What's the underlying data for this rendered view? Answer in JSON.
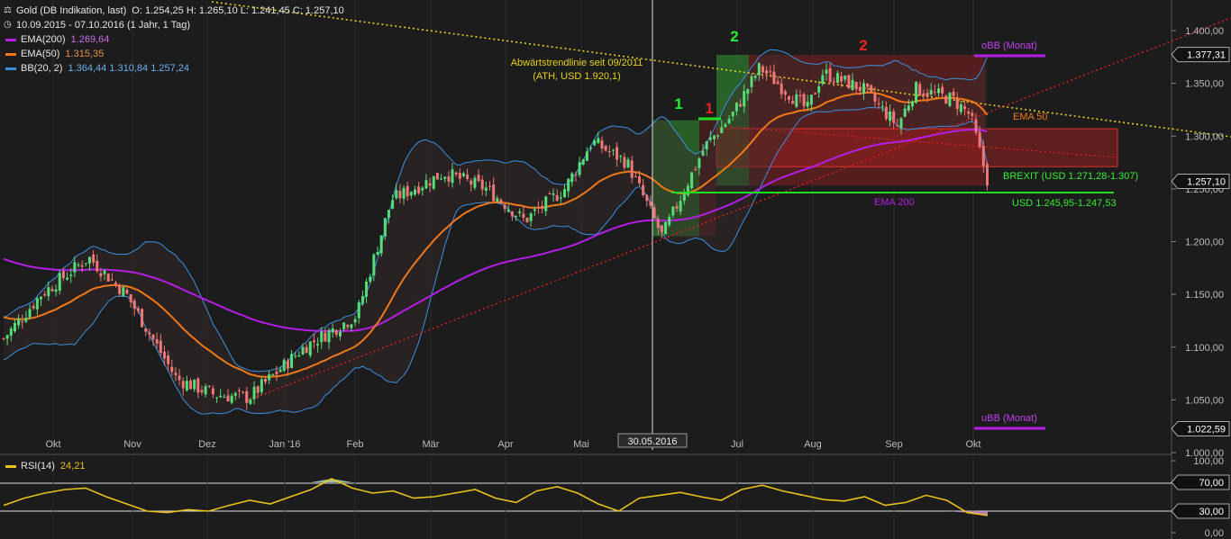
{
  "header": {
    "title": "Gold (DB Indikation, last)",
    "ohlc": "O: 1.254,25  H: 1.265,10  L: 1.241,45  C: 1.257,10",
    "range": "10.09.2015 - 07.10.2016 (1 Jahr, 1 Tag)"
  },
  "legend": [
    {
      "label": "EMA(200)",
      "values": "1.269,64",
      "color": "#b41ee6"
    },
    {
      "label": "EMA(50)",
      "values": "1.315,35",
      "color": "#f07818"
    },
    {
      "label": "BB(20, 2)",
      "values": "1.364,44  1.310,84  1.257,24",
      "color": "#3a90e0"
    }
  ],
  "rsi": {
    "label": "RSI(14)",
    "value": "24,21"
  },
  "colors": {
    "up": "#55dd77",
    "down": "#ee7777",
    "ema200": "#b41ee6",
    "ema50": "#f07818",
    "bb": "#3a90e0",
    "rsi": "#e8c21a"
  },
  "chart_data": {
    "type": "candlestick",
    "ylim": [
      1000,
      1420
    ],
    "y_ticks": [
      "1.400,00",
      "1.350,00",
      "1.300,00",
      "1.250,00",
      "1.200,00",
      "1.150,00",
      "1.100,00",
      "1.050,00",
      "1.000,00"
    ],
    "x_ticks": [
      "Okt",
      "Nov",
      "Dez",
      "Jan '16",
      "Feb",
      "Mär",
      "Apr",
      "Mai",
      "Jul",
      "Aug",
      "Sep",
      "Okt"
    ],
    "crosshair_date": "30.05.2016",
    "price_labels": [
      "1.377,31",
      "1.257,10",
      "1.022,59"
    ],
    "close_series": [
      {
        "date": "2015-09-10",
        "value": 1108
      },
      {
        "date": "2015-09-25",
        "value": 1150
      },
      {
        "date": "2015-10-14",
        "value": 1185
      },
      {
        "date": "2015-10-29",
        "value": 1150
      },
      {
        "date": "2015-11-18",
        "value": 1070
      },
      {
        "date": "2015-12-03",
        "value": 1055
      },
      {
        "date": "2015-12-17",
        "value": 1052
      },
      {
        "date": "2016-01-08",
        "value": 1100
      },
      {
        "date": "2016-01-29",
        "value": 1130
      },
      {
        "date": "2016-02-12",
        "value": 1240
      },
      {
        "date": "2016-03-04",
        "value": 1265
      },
      {
        "date": "2016-03-21",
        "value": 1250
      },
      {
        "date": "2016-04-05",
        "value": 1220
      },
      {
        "date": "2016-04-21",
        "value": 1250
      },
      {
        "date": "2016-05-02",
        "value": 1295
      },
      {
        "date": "2016-05-16",
        "value": 1275
      },
      {
        "date": "2016-05-30",
        "value": 1205
      },
      {
        "date": "2016-06-16",
        "value": 1290
      },
      {
        "date": "2016-06-27",
        "value": 1320
      },
      {
        "date": "2016-07-08",
        "value": 1365
      },
      {
        "date": "2016-07-27",
        "value": 1325
      },
      {
        "date": "2016-08-02",
        "value": 1360
      },
      {
        "date": "2016-08-18",
        "value": 1345
      },
      {
        "date": "2016-09-01",
        "value": 1310
      },
      {
        "date": "2016-09-08",
        "value": 1345
      },
      {
        "date": "2016-09-23",
        "value": 1335
      },
      {
        "date": "2016-09-30",
        "value": 1320
      },
      {
        "date": "2016-10-07",
        "value": 1257
      }
    ],
    "rsi_ylim": [
      0,
      100
    ],
    "rsi_ticks": [
      "100,00",
      "70,00",
      "30,00",
      "0,00"
    ],
    "rsi_series": [
      38,
      48,
      55,
      60,
      62,
      50,
      40,
      30,
      28,
      32,
      30,
      38,
      45,
      40,
      50,
      60,
      75,
      62,
      55,
      58,
      48,
      50,
      55,
      60,
      48,
      42,
      58,
      64,
      55,
      40,
      30,
      48,
      52,
      56,
      50,
      45,
      60,
      66,
      58,
      52,
      46,
      44,
      50,
      38,
      42,
      52,
      45,
      28,
      24
    ],
    "annotations": {
      "trendline_label": "Abwärtstrendlinie seit 09/2011",
      "trendline_sub": "(ATH, USD 1.920,1)",
      "obb": "oBB (Monat)",
      "ubb": "uBB (Monat)",
      "ema50": "EMA 50",
      "ema200": "EMA 200",
      "brexit": "BREXIT (USD 1.271,28-1.307)",
      "support": "USD 1.245,95-1.247,53",
      "wave_green_1": "1",
      "wave_green_2": "2",
      "wave_red_1": "1",
      "wave_red_2": "2"
    }
  }
}
